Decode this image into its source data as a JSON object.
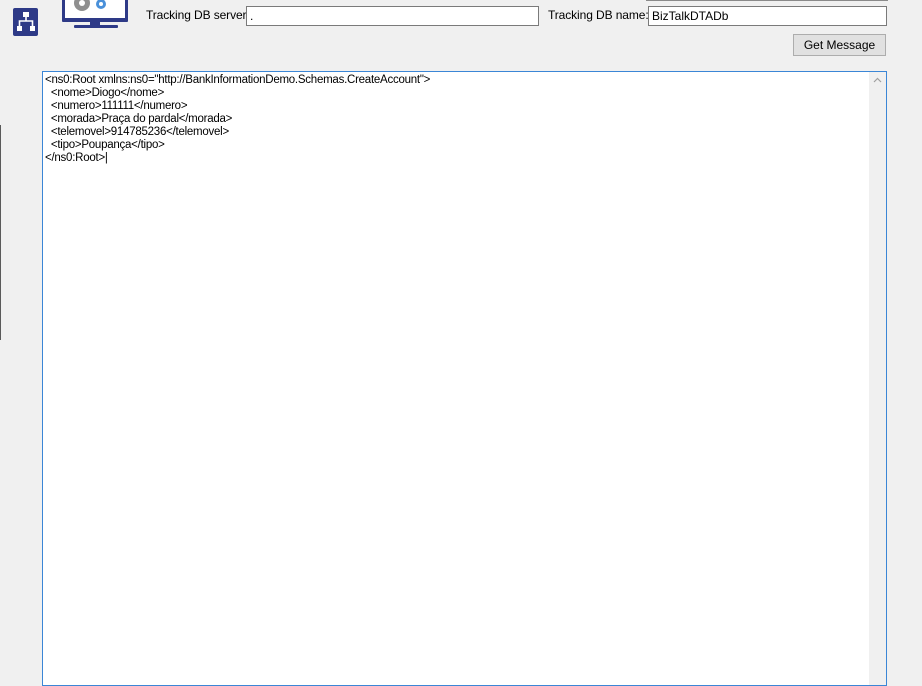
{
  "header": {
    "tracking_server_label": "Tracking DB server:",
    "tracking_server_value": ".",
    "tracking_db_label": "Tracking DB name:",
    "tracking_db_value": "BizTalkDTADb",
    "get_message_label": "Get Message",
    "logo_icon": "biztalk-app-logo-icon"
  },
  "editor": {
    "content": "<ns0:Root xmlns:ns0=\"http://BankInformationDemo.Schemas.CreateAccount\">\n  <nome>Diogo</nome>\n  <numero>111111</numero>\n  <morada>Praça do pardal</morada>\n  <telemovel>914785236</telemovel>\n  <tipo>Poupança</tipo>\n</ns0:Root>|",
    "scroll_up_icon": "chevron-up-icon"
  },
  "colors": {
    "window_bg": "#f0f0f0",
    "editor_focus_border": "#3b86d6",
    "logo_navy": "#2e3a87"
  }
}
